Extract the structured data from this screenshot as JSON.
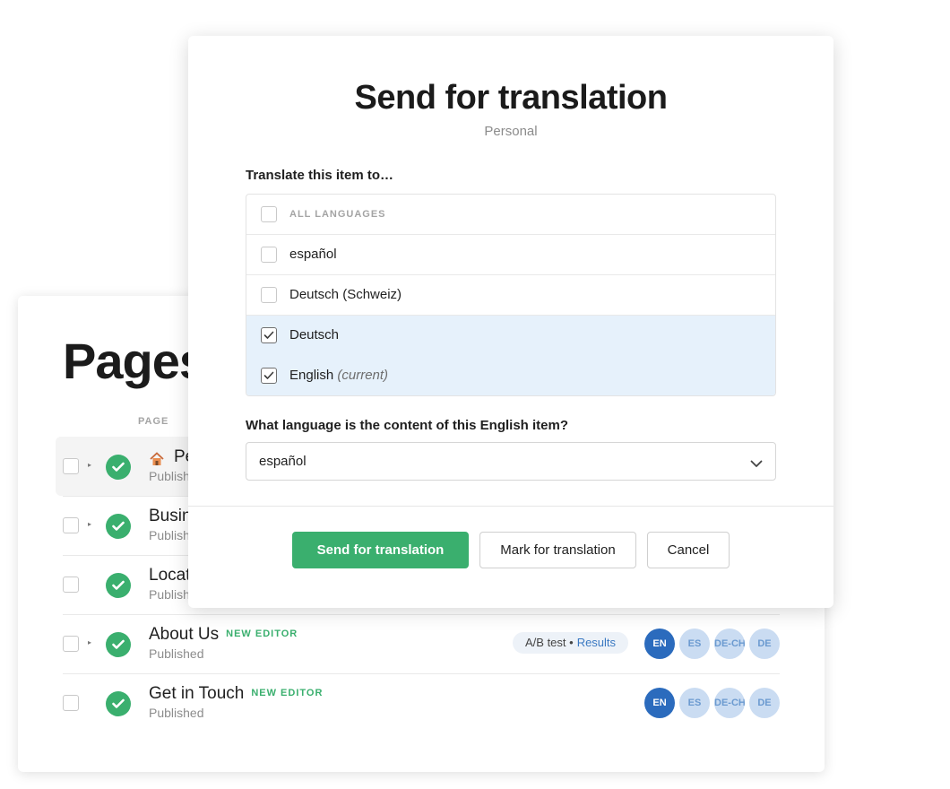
{
  "pages": {
    "title": "Pages",
    "column_header": "PAGE",
    "rows": [
      {
        "name": "Pe",
        "status": "Publish",
        "has_caret": true,
        "icon": "home-icon"
      },
      {
        "name": "Busin",
        "status": "Publish",
        "has_caret": true
      },
      {
        "name": "Locat",
        "status": "Publish",
        "has_caret": false
      },
      {
        "name": "About Us",
        "badge": "NEW EDITOR",
        "status": "Published",
        "has_caret": true,
        "ab_test": {
          "label": "A/B test •",
          "link": "Results"
        },
        "languages": [
          "EN",
          "ES",
          "DE-CH",
          "DE"
        ]
      },
      {
        "name": "Get in Touch",
        "badge": "NEW EDITOR",
        "status": "Published",
        "has_caret": false,
        "languages": [
          "EN",
          "ES",
          "DE-CH",
          "DE"
        ]
      }
    ]
  },
  "modal": {
    "title": "Send for translation",
    "subtitle": "Personal",
    "translate_label": "Translate this item to…",
    "language_options": [
      {
        "label": "ALL LANGUAGES",
        "checked": false
      },
      {
        "label": "español",
        "checked": false
      },
      {
        "label": "Deutsch (Schweiz)",
        "checked": false
      },
      {
        "label": "Deutsch",
        "checked": true
      },
      {
        "label": "English",
        "note": "(current)",
        "checked": true
      }
    ],
    "content_language_label": "What language is the content of this English item?",
    "content_language_value": "español",
    "buttons": {
      "send": "Send for translation",
      "mark": "Mark for translation",
      "cancel": "Cancel"
    }
  },
  "colors": {
    "primary_green": "#3aaf6e",
    "selected_row": "#e6f1fb",
    "lang_active": "#2b6bbd",
    "lang_inactive": "#cadcf2"
  }
}
